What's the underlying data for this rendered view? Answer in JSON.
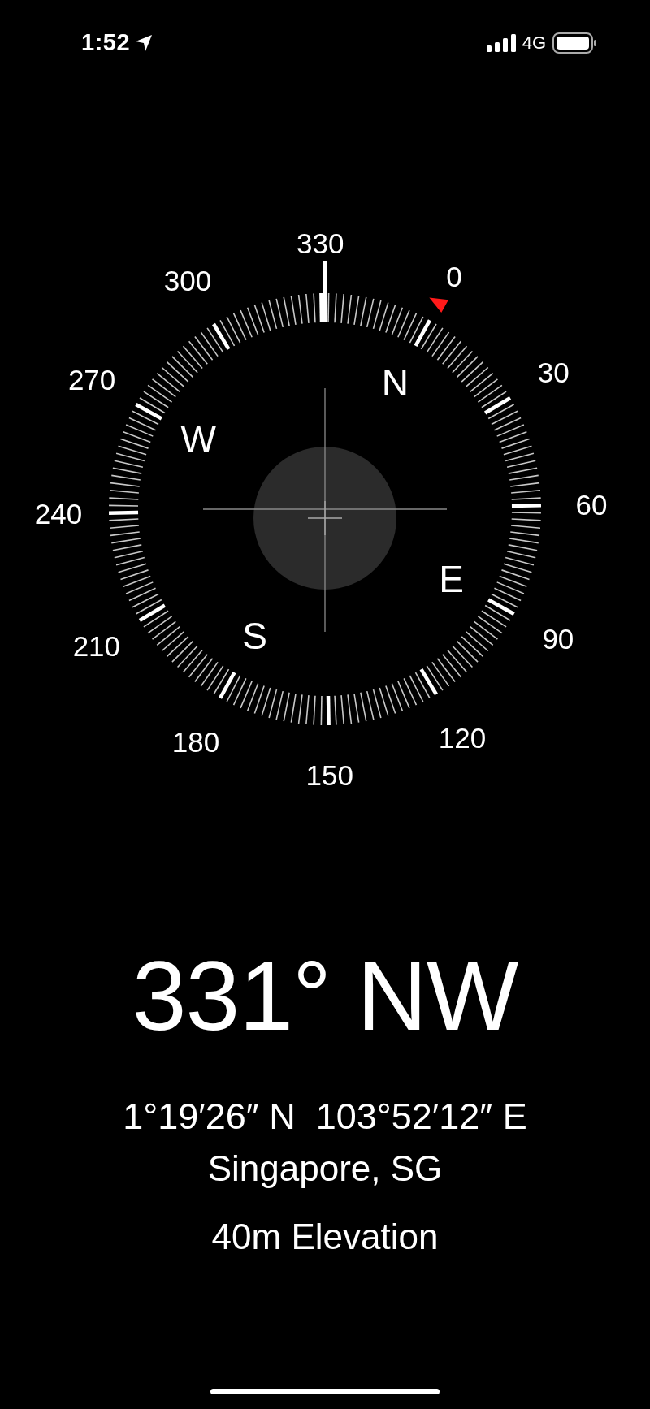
{
  "status_bar": {
    "time": "1:52",
    "network": "4G"
  },
  "compass": {
    "dial_labels": [
      "0",
      "30",
      "60",
      "90",
      "120",
      "150",
      "180",
      "210",
      "240",
      "270",
      "300",
      "330"
    ],
    "cardinals": [
      "N",
      "E",
      "S",
      "W"
    ]
  },
  "heading": "331° NW",
  "coordinates": "1°19′26″ N  103°52′12″ E",
  "location": "Singapore, SG",
  "elevation": "40m Elevation"
}
